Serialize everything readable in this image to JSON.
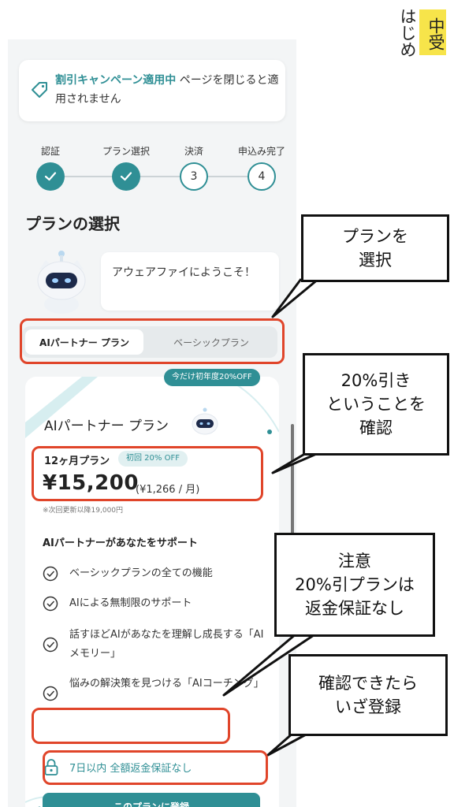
{
  "banner": {
    "highlight": "割引キャンペーン適用中",
    "rest": " ページを閉じると適用されません",
    "icon": "tag-icon"
  },
  "steps": [
    {
      "label": "認証",
      "state": "done",
      "num": ""
    },
    {
      "label": "プラン選択",
      "state": "done",
      "num": ""
    },
    {
      "label": "決済",
      "state": "todo",
      "num": "3"
    },
    {
      "label": "申込み完了",
      "state": "todo",
      "num": "4"
    }
  ],
  "heading": "プランの選択",
  "welcome": "アウェアファイにようこそ！",
  "tabs": {
    "active": "AIパートナー プラン",
    "inactive": "ベーシックプラン"
  },
  "promo": "今だけ初年度20%OFF",
  "plan": {
    "title": "AIパートナー プラン",
    "term": "12ヶ月プラン",
    "badge": "初回 20% OFF",
    "price": "¥15,200",
    "per_month": "(¥1,266 / 月)",
    "renewal": "※次回更新以降19,000円",
    "support_title": "AIパートナーがあなたをサポート",
    "features": [
      "ベーシックプランの全ての機能",
      "AIによる無制限のサポート",
      "話すほどAIがあなたを理解し成長する「AIメモリー」",
      "悩みの解決策を見つける「AIコーチング」"
    ],
    "refund": "7日以内 全額返金保証なし",
    "cta": "このプランに登録"
  },
  "callouts": {
    "select_plan": "プランを\n選択",
    "discount": "20%引き\nということを\n確認",
    "warning": "注意\n20%引プランは\n返金保証なし",
    "register": "確認できたら\nいざ登録"
  },
  "logo": {
    "vertical": "はじめ",
    "badge": "中受"
  },
  "colors": {
    "accent": "#2f8f95",
    "annotation": "#e0452a",
    "logo_bg": "#f7e44a"
  }
}
